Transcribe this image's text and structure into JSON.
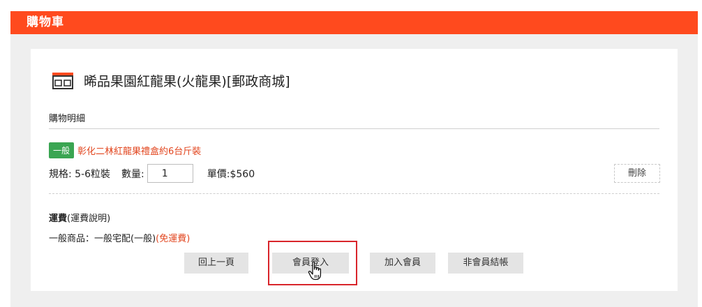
{
  "header": {
    "title": "購物車"
  },
  "store": {
    "name": "晞品果園紅龍果(火龍果)[郵政商城]",
    "icon": "store-icon"
  },
  "details": {
    "title": "購物明細"
  },
  "item": {
    "tag": "一般",
    "name": "彰化二林紅龍果禮盒約6台斤裝",
    "spec": "規格: 5-6粒裝",
    "qty_label": "數量:",
    "qty_value": "1",
    "price": "單價:$560",
    "delete_label": "刪除"
  },
  "shipping": {
    "title": "運費",
    "note": "(運費說明)",
    "info": "一般商品：一般宅配(一般)",
    "free": "(免運費)"
  },
  "buttons": {
    "prev": "回上一頁",
    "login": "會員登入",
    "join": "加入會員",
    "guest": "非會員結帳"
  },
  "colors": {
    "accent": "#ff4a1e",
    "tag": "#3aa552",
    "highlight": "#d9252b",
    "link": "#e2461f"
  }
}
